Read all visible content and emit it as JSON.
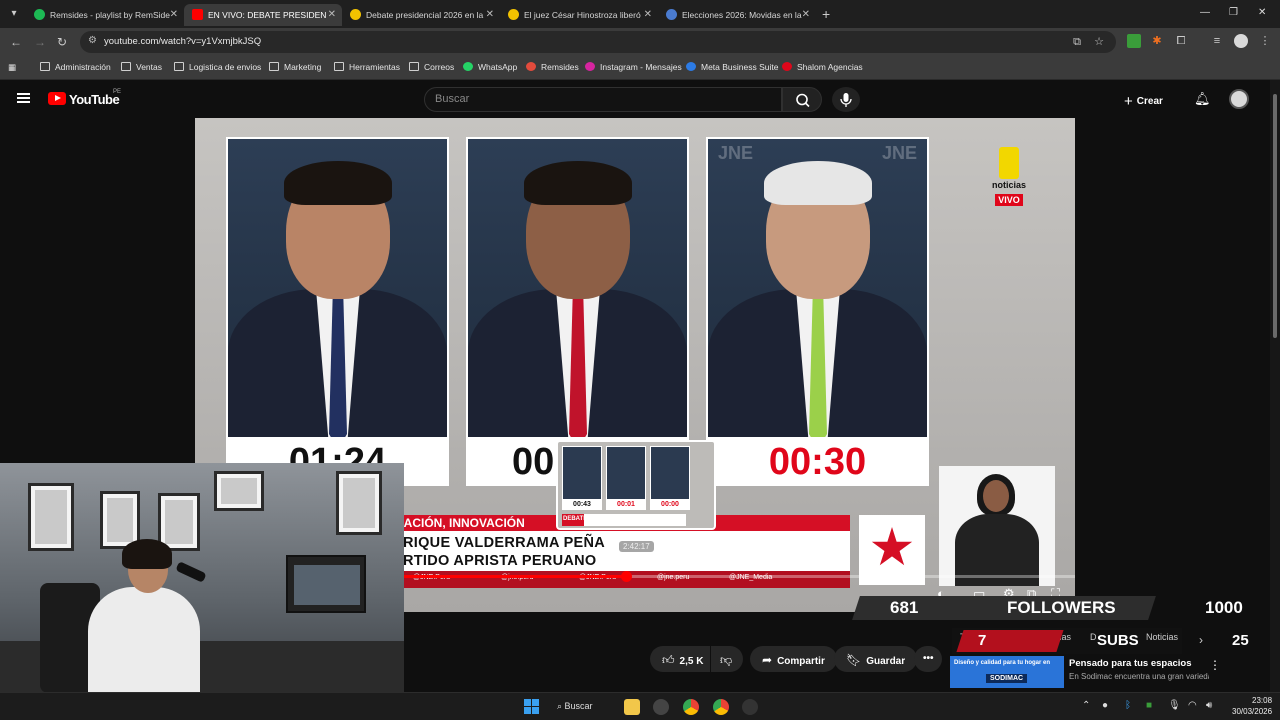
{
  "browser": {
    "tabs": [
      {
        "title": "Remsides - playlist by RemSide",
        "favicon_color": "#1db954"
      },
      {
        "title": "EN VIVO: DEBATE PRESIDEN",
        "favicon_color": "#ff0000"
      },
      {
        "title": "Debate presidencial 2026 en la",
        "favicon_color": "#f2c200"
      },
      {
        "title": "El juez César Hinostroza liberó",
        "favicon_color": "#f2c200"
      },
      {
        "title": "Elecciones 2026: Movidas en la",
        "favicon_color": "#4a7bd0"
      }
    ],
    "new_tab_label": "+",
    "url": "youtube.com/watch?v=y1VxmjbkJSQ",
    "bookmarks": [
      {
        "label": "Administración",
        "icon": "folder-icon"
      },
      {
        "label": "Ventas",
        "icon": "folder-icon"
      },
      {
        "label": "Logistica de envios",
        "icon": "folder-icon"
      },
      {
        "label": "Marketing",
        "icon": "folder-icon"
      },
      {
        "label": "Herramientas",
        "icon": "folder-icon"
      },
      {
        "label": "Correos",
        "icon": "folder-icon"
      },
      {
        "label": "WhatsApp",
        "icon": "whatsapp-icon",
        "color": "#25d366"
      },
      {
        "label": "Remsides",
        "icon": "remsides-icon",
        "color": "#e34b3c"
      },
      {
        "label": "Instagram - Mensajes",
        "icon": "instagram-icon",
        "color": "#d6249f"
      },
      {
        "label": "Meta Business Suite",
        "icon": "meta-icon",
        "color": "#2c7be5"
      },
      {
        "label": "Shalom Agencias",
        "icon": "shalom-icon",
        "color": "#e0061a"
      }
    ]
  },
  "youtube": {
    "logo_text": "YouTube",
    "country_code": "PE",
    "search_placeholder": "Buscar",
    "create_label": "Crear"
  },
  "video": {
    "timers": [
      "01:24",
      "00",
      "00:30"
    ],
    "timer_colors": [
      "#111111",
      "#111111",
      "#e0061a"
    ],
    "channel_logo_word": "noticias",
    "live_badge": "VIVO",
    "panel_watermark": "JNE",
    "band_text": "CACIÓN, INNOVACIÓN",
    "name_line1": "RIQUE VALDERRAMA PEÑA",
    "name_line2": "RTIDO APRISTA PERUANO",
    "social_handles": [
      "@JNE.Peru",
      "@jne.peru",
      "@JNE.Peru",
      "@jne.peru",
      "@JNE_Media"
    ],
    "preview_timers": [
      "00:43",
      "00:01",
      "00:00"
    ],
    "preview_band": "DEBATE",
    "preview_time": "2:42:17",
    "progress_fraction": 0.49
  },
  "stream_overlay": {
    "followers_count": "681",
    "followers_label": "FOLLOWERS",
    "followers_goal": "1000",
    "subs_count": "7",
    "subs_label": "SUBS",
    "subs_goal": "25",
    "chips": [
      "To",
      "cias",
      "D",
      "Noticias"
    ]
  },
  "actions": {
    "likes": "2,5 K",
    "share": "Compartir",
    "save": "Guardar"
  },
  "ad": {
    "banner_text": "Diseño y calidad para tu hogar en",
    "banner_brand": "SODIMAC",
    "title": "Pensado para tus espacios",
    "description": "En Sodimac encuentra una gran variedad en Muebles, ahorra en miles"
  },
  "taskbar": {
    "search_label": "Buscar",
    "time": "23:08",
    "date": "30/03/2026"
  }
}
